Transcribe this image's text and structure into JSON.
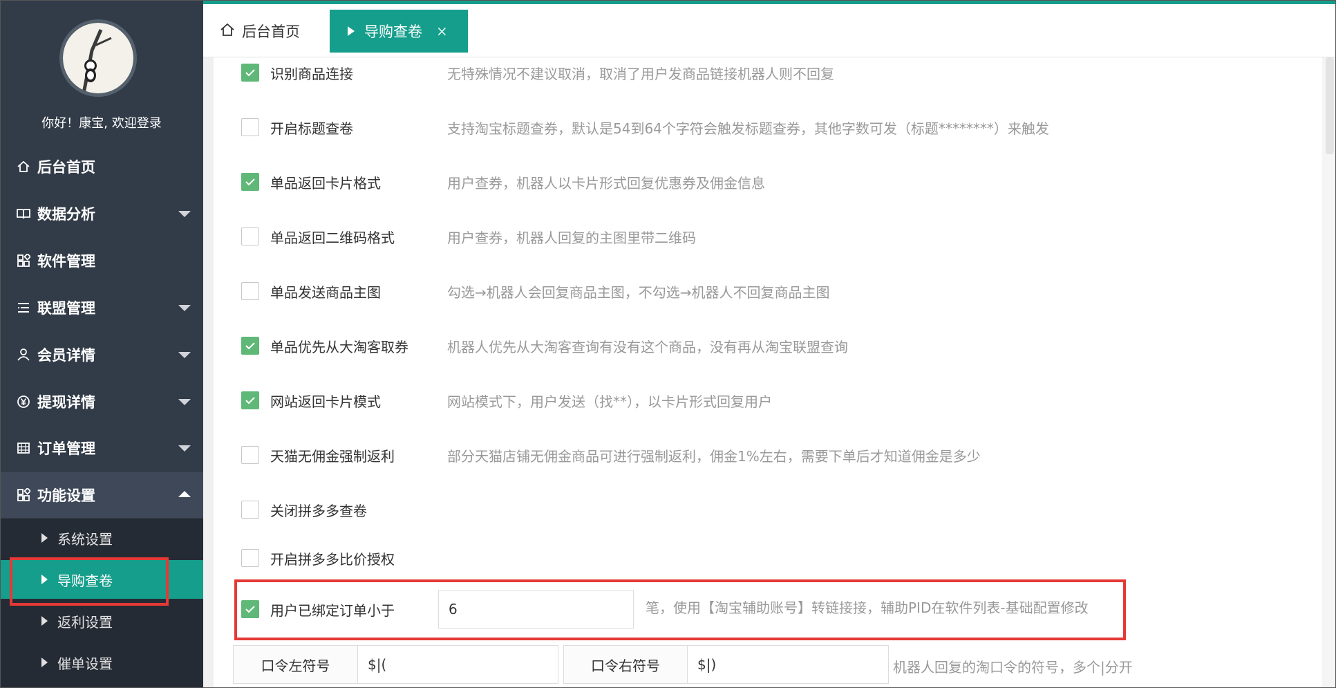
{
  "sidebar": {
    "welcome": "你好！康宝, 欢迎登录",
    "items": [
      {
        "label": "后台首页",
        "icon": "home-icon"
      },
      {
        "label": "数据分析",
        "icon": "book-icon"
      },
      {
        "label": "软件管理",
        "icon": "apps-icon"
      },
      {
        "label": "联盟管理",
        "icon": "list-icon"
      },
      {
        "label": "会员详情",
        "icon": "user-icon"
      },
      {
        "label": "提现详情",
        "icon": "yen-icon"
      },
      {
        "label": "订单管理",
        "icon": "grid-icon"
      },
      {
        "label": "功能设置",
        "icon": "apps-icon"
      }
    ],
    "sub_items": [
      {
        "label": "系统设置"
      },
      {
        "label": "导购查卷"
      },
      {
        "label": "返利设置"
      },
      {
        "label": "催单设置"
      }
    ]
  },
  "tabs": {
    "home": "后台首页",
    "active": "导购查卷",
    "close": "×"
  },
  "options": [
    {
      "label": "识别商品连接",
      "desc": "无特殊情况不建议取消，取消了用户发商品链接机器人则不回复",
      "checked": true
    },
    {
      "label": "开启标题查卷",
      "desc": "支持淘宝标题查券，默认是54到64个字符会触发标题查券，其他字数可发（标题********）来触发",
      "checked": false
    },
    {
      "label": "单品返回卡片格式",
      "desc": "用户查券，机器人以卡片形式回复优惠券及佣金信息",
      "checked": true
    },
    {
      "label": "单品返回二维码格式",
      "desc": "用户查券，机器人回复的主图里带二维码",
      "checked": false
    },
    {
      "label": "单品发送商品主图",
      "desc": "勾选→机器人会回复商品主图，不勾选→机器人不回复商品主图",
      "checked": false
    },
    {
      "label": "单品优先从大淘客取券",
      "desc": "机器人优先从大淘客查询有没有这个商品，没有再从淘宝联盟查询",
      "checked": true
    },
    {
      "label": "网站返回卡片模式",
      "desc": "网站模式下，用户发送（找**），以卡片形式回复用户",
      "checked": true
    },
    {
      "label": "天猫无佣金强制返利",
      "desc": "部分天猫店铺无佣金商品可进行强制返利，佣金1%左右，需要下单后才知道佣金是多少",
      "checked": false
    },
    {
      "label": "关闭拼多多查卷",
      "desc": "",
      "checked": false
    },
    {
      "label": "开启拼多多比价授权",
      "desc": "",
      "checked": false
    }
  ],
  "bound_order": {
    "label": "用户已绑定订单小于",
    "value": "6",
    "checked": true,
    "suffix": "笔，使用【淘宝辅助账号】转链接接，辅助PID在软件列表-基础配置修改"
  },
  "token": {
    "left_label": "口令左符号",
    "left_value": "$|(",
    "right_label": "口令右符号",
    "right_value": "$|)",
    "hint": "机器人回复的淘口令的符号，多个|分开"
  },
  "colors": {
    "accent": "#159e8b",
    "checked": "#5fb878",
    "highlight": "#e53935",
    "sidebar": "#323b48"
  }
}
